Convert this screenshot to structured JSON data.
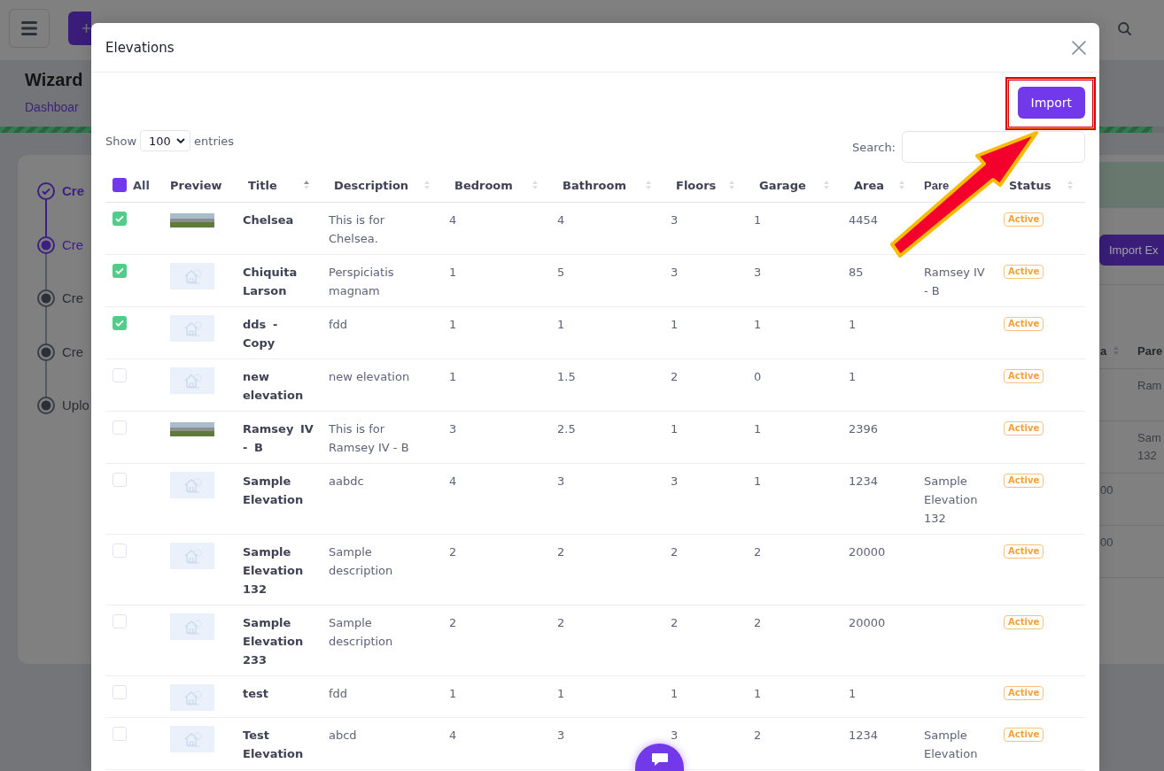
{
  "page": {
    "title": "Wizard",
    "breadcrumb": "Dashboar",
    "progress": {
      "level": 0.99
    },
    "steps": [
      {
        "label": "Cre",
        "kind": "done"
      },
      {
        "label": "Cre",
        "kind": "current"
      },
      {
        "label": "Cre",
        "kind": "pending"
      },
      {
        "label": "Cre",
        "kind": "pending"
      },
      {
        "label": "Uplo",
        "kind": "pending"
      }
    ],
    "import_button": "Import Ex",
    "table": {
      "columns": [
        {
          "label": "a",
          "sortable": true
        },
        {
          "label": "Pare",
          "sortable": false
        }
      ],
      "rows": [
        {
          "parent": "Ram"
        },
        {
          "parent": "Sam 132"
        },
        {
          "area": "00"
        },
        {
          "area": "00"
        }
      ]
    }
  },
  "modal": {
    "title": "Elevations",
    "import_button": "Import",
    "length_menu": {
      "before": "Show",
      "value": "100",
      "after": "entries"
    },
    "search": {
      "label": "Search:"
    },
    "table": {
      "select_all": {
        "label": "All",
        "indeterminate": true
      },
      "columns": [
        {
          "label": "Preview",
          "sortable": false,
          "sorted": false
        },
        {
          "label": "Title",
          "sortable": true,
          "sorted": true
        },
        {
          "label": "Description",
          "sortable": true,
          "sorted": false
        },
        {
          "label": "Bedroom",
          "sortable": true,
          "sorted": false
        },
        {
          "label": "Bathroom",
          "sortable": true,
          "sorted": false
        },
        {
          "label": "Floors",
          "sortable": true,
          "sorted": false
        },
        {
          "label": "Garage",
          "sortable": true,
          "sorted": false
        },
        {
          "label": "Area",
          "sortable": true,
          "sorted": false
        },
        {
          "label": "Pare",
          "sortable": false,
          "sorted": false
        },
        {
          "label": "Status",
          "sortable": true,
          "sorted": false
        }
      ],
      "rows": [
        {
          "checked": true,
          "preview": {
            "kind": "photo"
          },
          "title": "Chelsea",
          "description": "This is for Chelsea.",
          "bedroom": "4",
          "bathroom": "4",
          "floors": "3",
          "garage": "1",
          "area": "4454",
          "status": "Active"
        },
        {
          "checked": true,
          "preview": {
            "kind": "placeholder"
          },
          "title": "Chiquita Larson",
          "description": "Perspiciatis magnam",
          "bedroom": "1",
          "bathroom": "5",
          "floors": "3",
          "garage": "3",
          "area": "85",
          "parent": "Ramsey IV - B",
          "status": "Active"
        },
        {
          "checked": true,
          "preview": {
            "kind": "placeholder"
          },
          "title": "dds - Copy",
          "description": "fdd",
          "bedroom": "1",
          "bathroom": "1",
          "floors": "1",
          "garage": "1",
          "area": "1",
          "status": "Active"
        },
        {
          "checked": false,
          "preview": {
            "kind": "placeholder"
          },
          "title": "new elevation",
          "description": "new elevation",
          "bedroom": "1",
          "bathroom": "1.5",
          "floors": "2",
          "garage": "0",
          "area": "1",
          "status": "Active"
        },
        {
          "checked": false,
          "preview": {
            "kind": "photo"
          },
          "title": "Ramsey IV - B",
          "description": "This is for Ramsey IV - B",
          "bedroom": "3",
          "bathroom": "2.5",
          "floors": "1",
          "garage": "1",
          "area": "2396",
          "status": "Active"
        },
        {
          "checked": false,
          "preview": {
            "kind": "placeholder"
          },
          "title": "Sample Elevation",
          "description": "aabdc",
          "bedroom": "4",
          "bathroom": "3",
          "floors": "3",
          "garage": "1",
          "area": "1234",
          "parent": "Sample Elevation 132",
          "status": "Active"
        },
        {
          "checked": false,
          "preview": {
            "kind": "placeholder"
          },
          "title": "Sample Elevation 132",
          "description": "Sample description",
          "bedroom": "2",
          "bathroom": "2",
          "floors": "2",
          "garage": "2",
          "area": "20000",
          "status": "Active"
        },
        {
          "checked": false,
          "preview": {
            "kind": "placeholder"
          },
          "title": "Sample Elevation 233",
          "description": "Sample description",
          "bedroom": "2",
          "bathroom": "2",
          "floors": "2",
          "garage": "2",
          "area": "20000",
          "status": "Active"
        },
        {
          "checked": false,
          "preview": {
            "kind": "placeholder"
          },
          "title": "test",
          "description": "fdd",
          "bedroom": "1",
          "bathroom": "1",
          "floors": "1",
          "garage": "1",
          "area": "1",
          "status": "Active"
        },
        {
          "checked": false,
          "preview": {
            "kind": "placeholder"
          },
          "title": "Test Elevation",
          "description": "abcd",
          "bedroom": "4",
          "bathroom": "3",
          "floors": "3",
          "garage": "2",
          "area": "1234",
          "parent": "Sample Elevation",
          "status": "Active"
        }
      ]
    }
  }
}
